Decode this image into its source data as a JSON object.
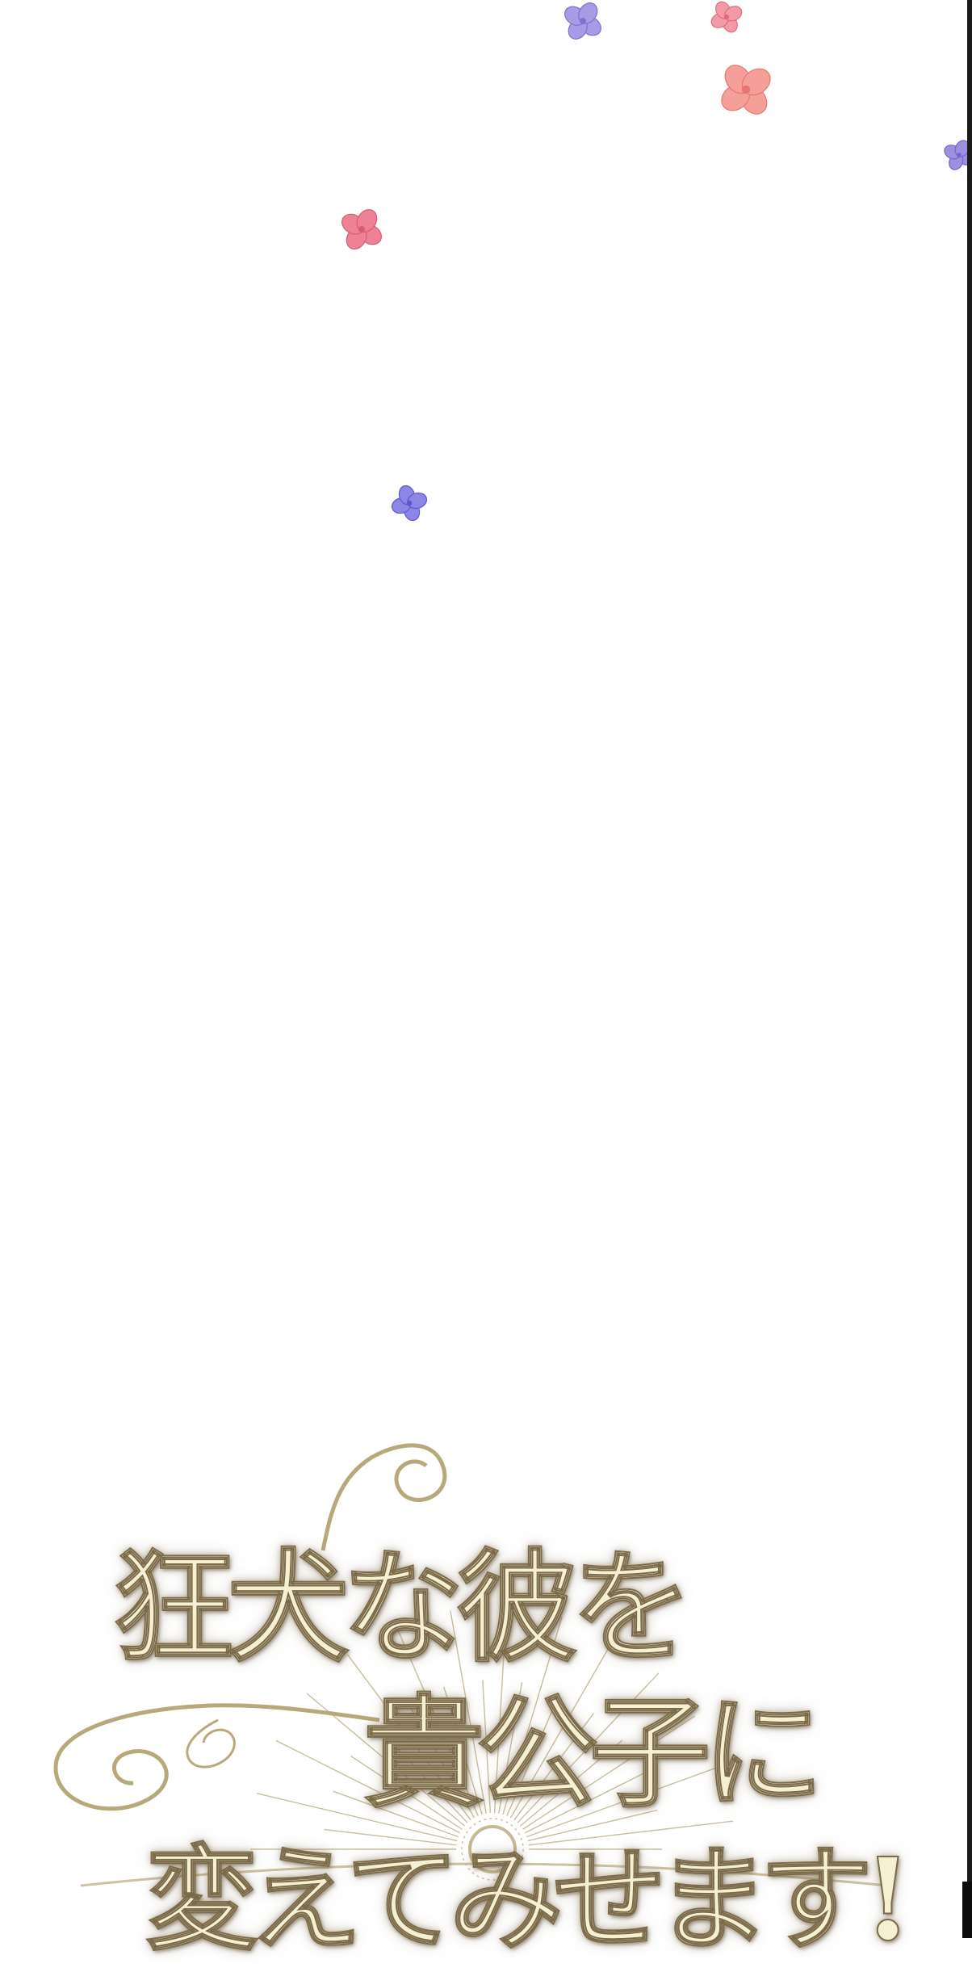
{
  "page": {
    "background": "#ffffff",
    "edge_color": "#1a1a1a"
  },
  "petals": [
    {
      "name": "hydrangea-petal-purple",
      "color": "#a79be6",
      "accent": "#7e70cf"
    },
    {
      "name": "hydrangea-petal-pink",
      "color": "#f29aa8",
      "accent": "#e0697c"
    },
    {
      "name": "hydrangea-petal-coral",
      "color": "#f4a099",
      "accent": "#e8766e"
    },
    {
      "name": "hydrangea-petal-lavender",
      "color": "#9d90e0",
      "accent": "#7565cc"
    },
    {
      "name": "hydrangea-petal-rose",
      "color": "#ef8197",
      "accent": "#d95a74"
    },
    {
      "name": "hydrangea-petal-blue",
      "color": "#8c86e6",
      "accent": "#5e57cf"
    }
  ],
  "title": {
    "line1": "狂犬な彼を",
    "line2": "貴公子に",
    "line3": "変えてみせます!",
    "fill_color": "#f6f0d2",
    "stroke_color": "#7a6a4a",
    "ornament_color": "#b8a97a"
  }
}
